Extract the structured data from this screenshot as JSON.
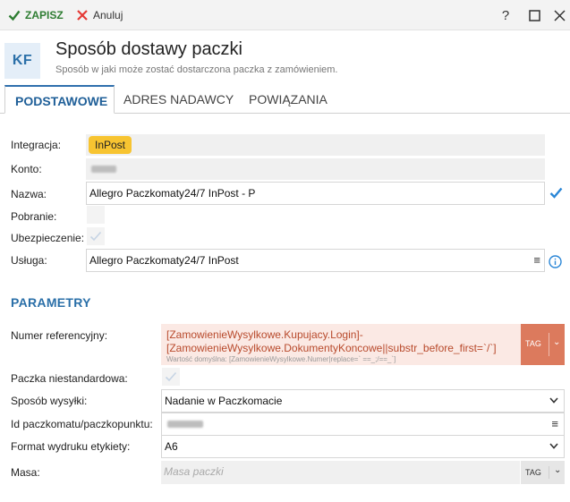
{
  "toolbar": {
    "save_label": "ZAPISZ",
    "cancel_label": "Anuluj",
    "help_label": "?",
    "colors": {
      "save": "#2e7d32",
      "cancel": "#e53935"
    }
  },
  "header": {
    "badge": "KF",
    "title": "Sposób dostawy paczki",
    "subtitle": "Sposób w jaki może zostać dostarczona paczka z zamówieniem."
  },
  "tabs": [
    {
      "label": "PODSTAWOWE",
      "active": true
    },
    {
      "label": "ADRES NADAWCY",
      "active": false
    },
    {
      "label": "POWIĄZANIA",
      "active": false
    }
  ],
  "basic": {
    "integration": {
      "label": "Integracja:",
      "value": "InPost",
      "color": "#f7c431"
    },
    "account": {
      "label": "Konto:"
    },
    "name": {
      "label": "Nazwa:",
      "value": "Allegro Paczkomaty24/7 InPost - P"
    },
    "cash_on_delivery": {
      "label": "Pobranie:",
      "checked": false
    },
    "insurance": {
      "label": "Ubezpieczenie:",
      "checked": false
    },
    "service": {
      "label": "Usługa:",
      "value": "Allegro Paczkomaty24/7 InPost"
    }
  },
  "params": {
    "section_title": "PARAMETRY",
    "ref_number": {
      "label": "Numer referencyjny:",
      "line1": "[ZamowienieWysylkowe.Kupujacy.Login]-",
      "line2": "[ZamowienieWysylkowe.DokumentyKoncowe||substr_before_first=`/`]",
      "hint": "Wartość domyślna: [ZamowienieWysylkowe.Numer|replace=` ==_;/==_`]",
      "tag_label": "TAG",
      "tag_color": "#dc7a5d"
    },
    "non_standard": {
      "label": "Paczka niestandardowa:",
      "checked": false
    },
    "shipping_method": {
      "label": "Sposób wysyłki:",
      "value": "Nadanie w Paczkomacie"
    },
    "locker_id": {
      "label": "Id paczkomatu/paczkopunktu:"
    },
    "label_format": {
      "label": "Format wydruku etykiety:",
      "value": "A6"
    },
    "weight": {
      "label": "Masa:",
      "placeholder": "Masa paczki",
      "tag_label": "TAG"
    }
  }
}
